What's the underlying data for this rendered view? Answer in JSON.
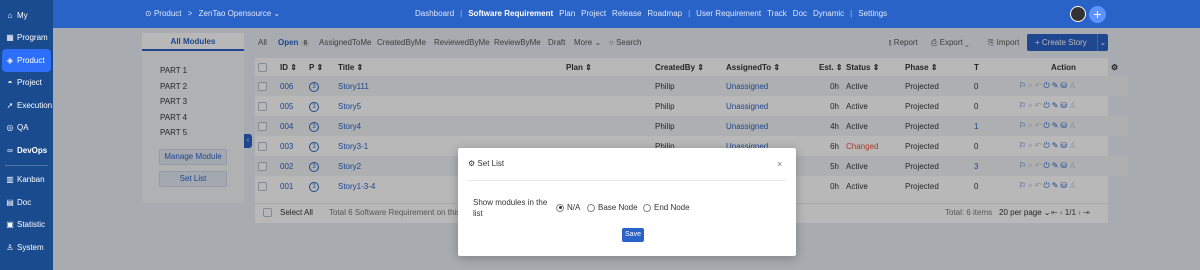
{
  "sidebar": {
    "items": [
      {
        "label": "My",
        "icon": "home-icon"
      },
      {
        "label": "Program",
        "icon": "grid-icon"
      },
      {
        "label": "Product",
        "icon": "product-icon"
      },
      {
        "label": "Project",
        "icon": "project-icon"
      },
      {
        "label": "Execution",
        "icon": "execution-icon"
      },
      {
        "label": "QA",
        "icon": "qa-icon"
      },
      {
        "label": "DevOps",
        "icon": "devops-icon"
      },
      {
        "label": "Kanban",
        "icon": "kanban-icon"
      },
      {
        "label": "Doc",
        "icon": "doc-icon"
      },
      {
        "label": "Statistic",
        "icon": "statistic-icon"
      },
      {
        "label": "System",
        "icon": "system-icon"
      }
    ]
  },
  "topbar": {
    "product": "Product",
    "breadcrumb_sep": ">",
    "product_name": "ZenTao Opensource",
    "nav": [
      "Dashboard",
      "Software Requirement",
      "Plan",
      "Project",
      "Release",
      "Roadmap",
      "User Requirement",
      "Track",
      "Doc",
      "Dynamic",
      "Settings"
    ],
    "current": "Software Requirement"
  },
  "left_panel": {
    "title": "All Modules",
    "modules": [
      "PART 1",
      "PART 2",
      "PART 3",
      "PART 4",
      "PART 5"
    ],
    "manage_label": "Manage Module",
    "setlist_label": "Set List"
  },
  "toolbar": {
    "tabs": [
      "All",
      "Open",
      "AssignedToMe",
      "CreatedByMe",
      "ReviewedByMe",
      "ReviewByMe",
      "Draft",
      "More"
    ],
    "open_count": "6",
    "search": "Search",
    "report": "Report",
    "export": "Export",
    "import": "Import",
    "create": "+ Create Story"
  },
  "table": {
    "headers": [
      "ID",
      "P",
      "Title",
      "Plan",
      "CreatedBy",
      "AssignedTo",
      "Est.",
      "Status",
      "Phase",
      "T",
      "Action"
    ],
    "rows": [
      {
        "id": "006",
        "p": "3",
        "title": "Story111",
        "plan": "",
        "created": "Philip",
        "assigned": "Unassigned",
        "est": "0h",
        "status": "Active",
        "phase": "Projected",
        "t": "0"
      },
      {
        "id": "005",
        "p": "3",
        "title": "Story5",
        "plan": "",
        "created": "Philip",
        "assigned": "Unassigned",
        "est": "0h",
        "status": "Active",
        "phase": "Projected",
        "t": "0"
      },
      {
        "id": "004",
        "p": "3",
        "title": "Story4",
        "plan": "",
        "created": "Philip",
        "assigned": "Unassigned",
        "est": "4h",
        "status": "Active",
        "phase": "Projected",
        "t": "1"
      },
      {
        "id": "003",
        "p": "3",
        "title": "Story3-1",
        "plan": "",
        "created": "Philip",
        "assigned": "Unassigned",
        "est": "6h",
        "status": "Changed",
        "phase": "Projected",
        "t": "0"
      },
      {
        "id": "002",
        "p": "3",
        "title": "Story2",
        "plan": "",
        "created": "Philip",
        "assigned": "Unassigned",
        "est": "5h",
        "status": "Active",
        "phase": "Projected",
        "t": "3"
      },
      {
        "id": "001",
        "p": "3",
        "title": "Story1-3-4",
        "plan": "",
        "created": "Philip",
        "assigned": "Unassigned",
        "est": "0h",
        "status": "Active",
        "phase": "Projected",
        "t": "0"
      }
    ],
    "footer": {
      "select_all": "Select All",
      "summary": "Total 6 Software Requirement on this page",
      "total_items": "Total: 6 items",
      "per_page": "20 per page",
      "page": "1/1"
    }
  },
  "modal": {
    "title": "Set List",
    "close": "×",
    "label": "Show modules in the list",
    "options": [
      "N/A",
      "Base Node",
      "End Node"
    ],
    "selected": "N/A",
    "save": "Save"
  },
  "colors": {
    "sidebar": "#1a4b8f",
    "topbar": "#2a63c7",
    "accent": "#2a63c7",
    "changed": "#e8543b"
  }
}
